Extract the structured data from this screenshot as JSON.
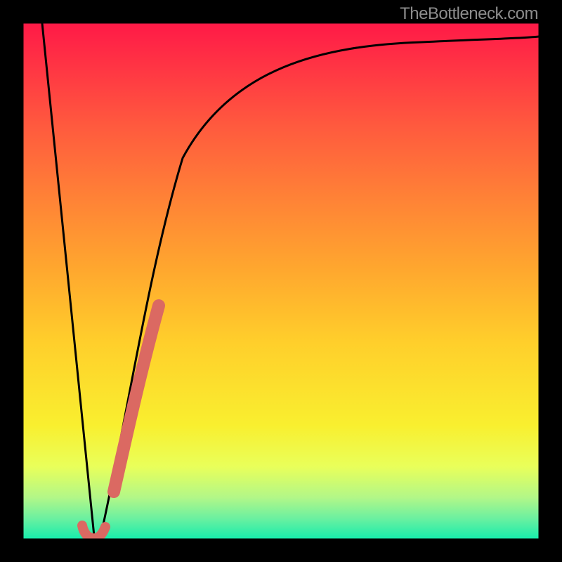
{
  "attribution": "TheBottleneck.com",
  "colors": {
    "overlay_fill": "#db6962",
    "curve_stroke": "#000000",
    "frame": "#000000"
  },
  "chart_data": {
    "type": "line",
    "title": "",
    "xlabel": "",
    "ylabel": "",
    "xlim": [
      0,
      100
    ],
    "ylim": [
      0,
      100
    ],
    "series": [
      {
        "name": "bottleneck-curve",
        "x": [
          0,
          5,
          10,
          12,
          14,
          16,
          18,
          20,
          22,
          24,
          26,
          28,
          30,
          35,
          40,
          50,
          60,
          70,
          80,
          90,
          100
        ],
        "values": [
          100,
          60,
          20,
          4,
          0,
          7,
          18,
          29,
          38,
          47,
          54,
          60,
          64,
          72,
          78,
          85,
          89,
          92,
          94,
          95,
          96
        ]
      }
    ],
    "overlay_segment": {
      "name": "highlighted-range",
      "x_start": 16.5,
      "x_end": 23.5,
      "y_start": 3,
      "y_end": 44
    }
  }
}
